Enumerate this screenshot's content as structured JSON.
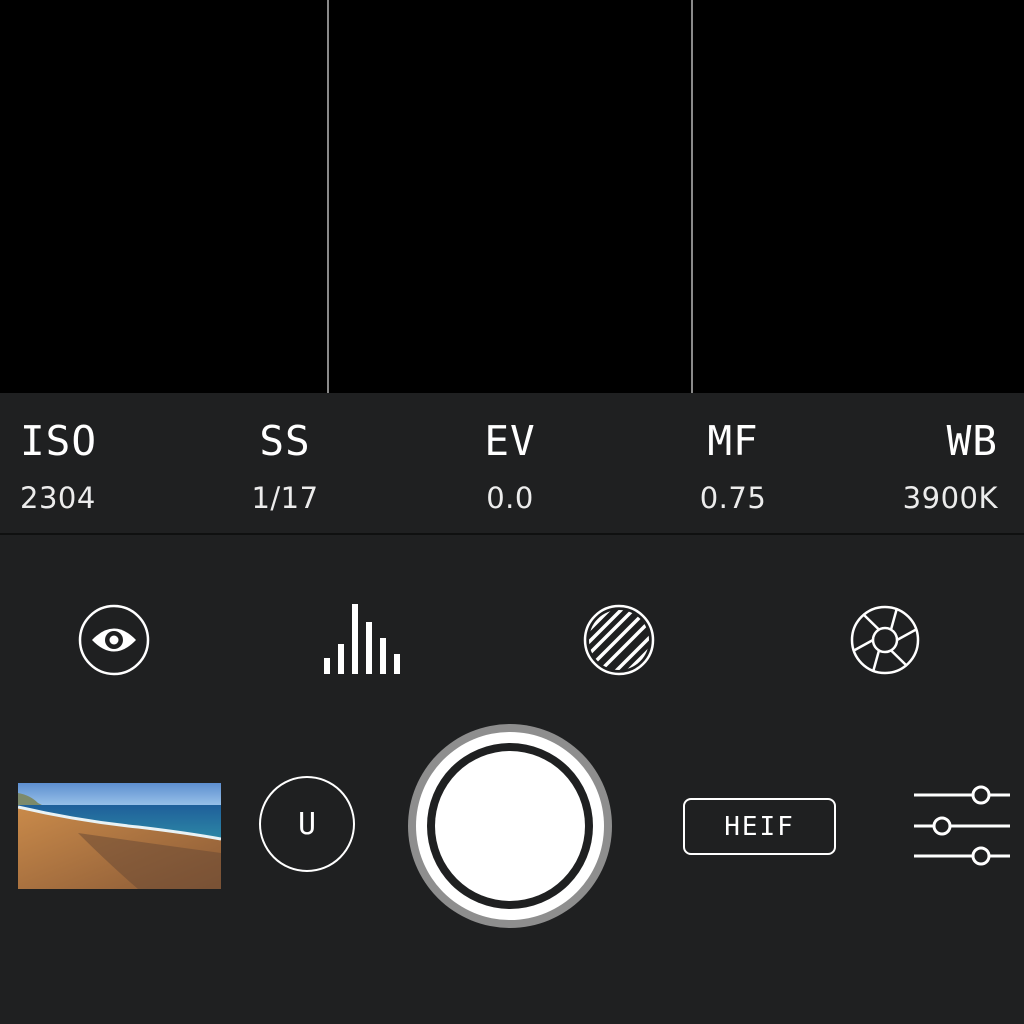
{
  "params": [
    {
      "label": "ISO",
      "value": "2304"
    },
    {
      "label": "SS",
      "value": "1/17"
    },
    {
      "label": "EV",
      "value": "0.0"
    },
    {
      "label": "MF",
      "value": "0.75"
    },
    {
      "label": "WB",
      "value": "3900K"
    }
  ],
  "tools": [
    {
      "icon": "eye-icon"
    },
    {
      "icon": "histogram-icon"
    },
    {
      "icon": "zebra-stripes-icon"
    },
    {
      "icon": "aperture-icon"
    }
  ],
  "controls": {
    "mode_label": "U",
    "format_label": "HEIF",
    "shutter_icon": "shutter-button-icon",
    "settings_icon": "sliders-icon",
    "thumbnail": "beach-photo-thumbnail"
  },
  "colors": {
    "background": "#1f2021",
    "viewfinder": "#000000",
    "foreground": "#ffffff",
    "shutter_ring": "#8e8e8e"
  }
}
